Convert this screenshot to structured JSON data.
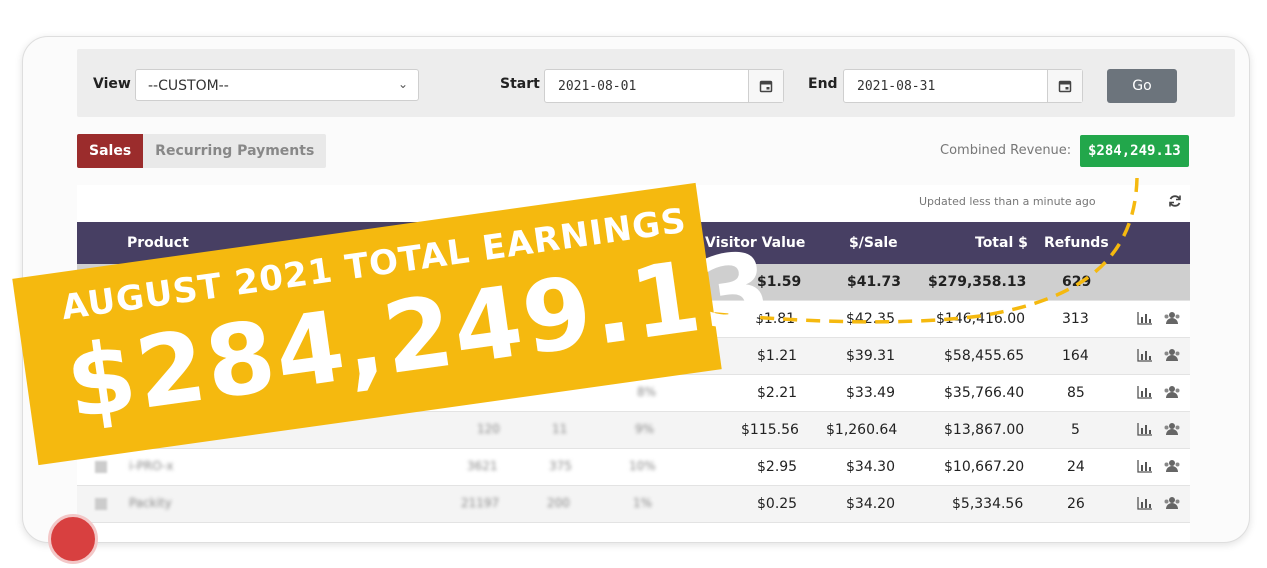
{
  "filters": {
    "view_label": "View",
    "view_value": "--CUSTOM--",
    "start_label": "Start",
    "start_value": "2021-08-01",
    "end_label": "End",
    "end_value": "2021-08-31",
    "go_label": "Go"
  },
  "tabs": [
    {
      "label": "Sales",
      "active": true
    },
    {
      "label": "Recurring Payments",
      "active": false
    }
  ],
  "combined_revenue": {
    "label": "Combined Revenue:",
    "value": "$284,249.13"
  },
  "updated_text": "Updated less than a minute ago",
  "table": {
    "columns": {
      "product": "Product",
      "visitor_value": "Visitor Value",
      "per_sale": "$/Sale",
      "total": "Total $",
      "refunds": "Refunds"
    },
    "total_row": {
      "visitor_value": "$1.59",
      "per_sale": "$41.73",
      "total": "$279,358.13",
      "refunds": "629"
    },
    "rows": [
      {
        "product": "",
        "visits": "",
        "sales": "",
        "conv": "",
        "visitor_value": "$1.81",
        "per_sale": "$42.35",
        "total": "$146,416.00",
        "refunds": "313"
      },
      {
        "product": "",
        "visits": "",
        "sales": "",
        "conv": "",
        "visitor_value": "$1.21",
        "per_sale": "$39.31",
        "total": "$58,455.65",
        "refunds": "164"
      },
      {
        "product": "",
        "visits": "",
        "sales": "",
        "conv": "8%",
        "visitor_value": "$2.21",
        "per_sale": "$33.49",
        "total": "$35,766.40",
        "refunds": "85"
      },
      {
        "product": "",
        "visits": "120",
        "sales": "11",
        "conv": "9%",
        "visitor_value": "$115.56",
        "per_sale": "$1,260.64",
        "total": "$13,867.00",
        "refunds": "5"
      },
      {
        "product": "i-PRO-x",
        "visits": "3621",
        "sales": "375",
        "conv": "10%",
        "visitor_value": "$2.95",
        "per_sale": "$34.30",
        "total": "$10,667.20",
        "refunds": "24"
      },
      {
        "product": "Packity",
        "visits": "21197",
        "sales": "200",
        "conv": "1%",
        "visitor_value": "$0.25",
        "per_sale": "$34.20",
        "total": "$5,334.56",
        "refunds": "26"
      }
    ]
  },
  "banner": {
    "line1": "AUGUST 2021 TOTAL EARNINGS",
    "line2": "$284,249.13"
  },
  "colors": {
    "header_bg": "#473f63",
    "sales_tab": "#9b2c2c",
    "revenue_badge": "#22a74b",
    "banner": "#f5b90f",
    "go_button": "#6c747c"
  },
  "icons": {
    "calendar": "calendar-icon",
    "refresh": "refresh-icon",
    "chart": "bar-chart-icon",
    "users": "users-icon"
  }
}
